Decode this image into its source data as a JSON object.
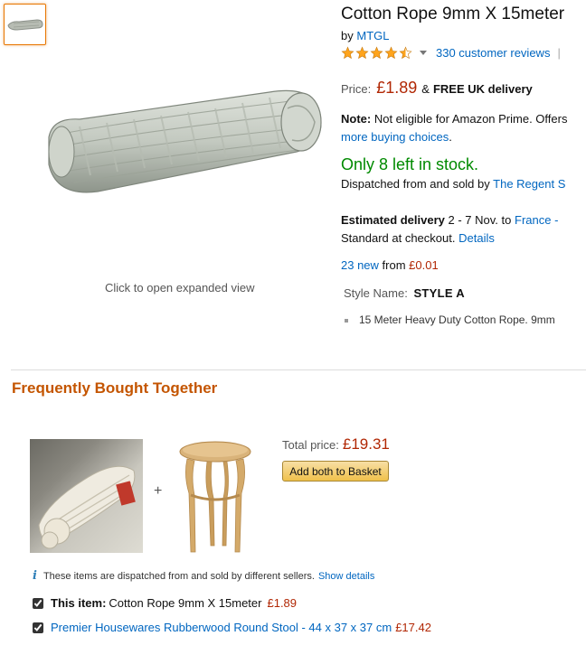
{
  "product": {
    "title": "Cotton Rope 9mm X 15meter",
    "by_prefix": "by",
    "brand": "MTGL",
    "rating": 4.5,
    "reviews_text": "330 customer reviews",
    "pipe": "|",
    "price_label": "Price:",
    "price": "£1.89",
    "amp": "&",
    "free_delivery": "FREE UK delivery",
    "note_label": "Note:",
    "note_text": "Not eligible for Amazon Prime. Offers",
    "note_link": "more buying choices",
    "note_end": ".",
    "stock": "Only 8 left in stock.",
    "dispatched_text": "Dispatched from and sold by",
    "seller": "The Regent S",
    "est_label": "Estimated delivery",
    "est_dates": "2 - 7 Nov.",
    "est_to": "to",
    "est_dest": "France -",
    "est_line2": "Standard at checkout.",
    "details_link": "Details",
    "new_count": "23 new",
    "new_from": "from",
    "new_price": "£0.01",
    "style_label": "Style Name:",
    "style_value": "STYLE A",
    "bullet": "15 Meter Heavy Duty Cotton Rope. 9mm",
    "expand_text": "Click to open expanded view"
  },
  "fbt": {
    "title": "Frequently Bought Together",
    "plus": "+",
    "total_label": "Total price:",
    "total_price": "£19.31",
    "add_button": "Add both to Basket",
    "info_icon": "i",
    "info_text": "These items are dispatched from and sold by different sellers.",
    "show_details": "Show details",
    "items": [
      {
        "prefix": "This item:",
        "name": "Cotton Rope 9mm X 15meter",
        "price": "£1.89",
        "checked": true
      },
      {
        "prefix": "",
        "name": "Premier Housewares Rubberwood Round Stool - 44 x 37 x 37 cm",
        "price": "£17.42",
        "checked": true
      }
    ]
  },
  "colors": {
    "price": "#b12704",
    "link": "#0066c0",
    "stock": "#008a00",
    "section_title": "#c45500",
    "star": "#ffa41c"
  },
  "icons": {
    "thumbnail": "rope-thumbnail-icon",
    "main_image": "rope-product-image",
    "stars": "rating-stars-icon",
    "caret": "chevron-down-icon",
    "info": "info-icon",
    "stool": "stool-image"
  }
}
